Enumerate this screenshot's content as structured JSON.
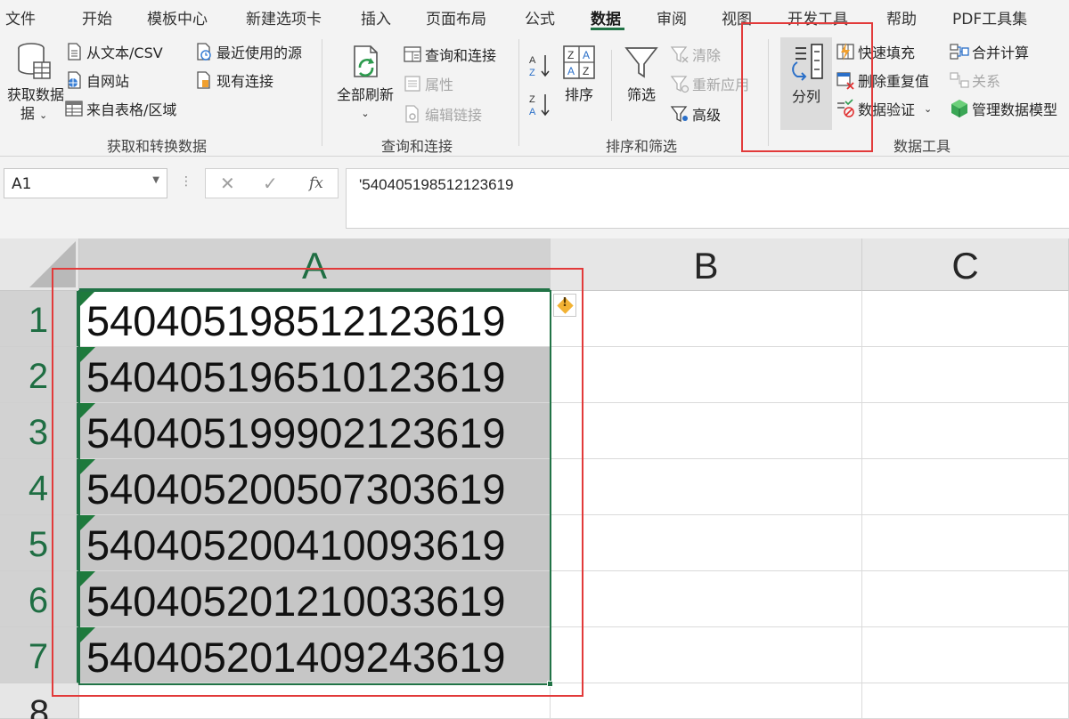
{
  "ribbon": {
    "tabs": [
      "文件",
      "开始",
      "模板中心",
      "新建选项卡",
      "插入",
      "页面布局",
      "公式",
      "数据",
      "审阅",
      "视图",
      "开发工具",
      "帮助",
      "PDF工具集"
    ],
    "active_tab": "数据",
    "get_transform": {
      "get_data": "获取数据",
      "get_data_line2": "据",
      "from_text": "从文本/CSV",
      "from_web": "自网站",
      "from_table": "来自表格/区域",
      "recent_sources": "最近使用的源",
      "existing_connections": "现有连接",
      "label": "获取和转换数据"
    },
    "queries": {
      "refresh_all": "全部刷新",
      "queries_connections": "查询和连接",
      "properties": "属性",
      "edit_links": "编辑链接",
      "label": "查询和连接"
    },
    "sort_filter": {
      "sort": "排序",
      "filter": "筛选",
      "clear": "清除",
      "reapply": "重新应用",
      "advanced": "高级",
      "label": "排序和筛选"
    },
    "data_tools": {
      "text_to_columns": "分列",
      "flash_fill": "快速填充",
      "remove_duplicates": "删除重复值",
      "data_validation": "数据验证",
      "consolidate": "合并计算",
      "relationships": "关系",
      "manage_data_model": "管理数据模型",
      "label": "数据工具"
    }
  },
  "formula_bar": {
    "name_box": "A1",
    "fx": "fx",
    "cancel": "✕",
    "enter": "✓",
    "content": "'540405198512123619"
  },
  "sheet": {
    "columns": [
      "A",
      "B",
      "C"
    ],
    "rows": [
      "1",
      "2",
      "3",
      "4",
      "5",
      "6",
      "7",
      "8"
    ],
    "column_a_values": [
      "540405198512123619",
      "540405196510123619",
      "540405199902123619",
      "540405200507303619",
      "540405200410093619",
      "540405201210033619",
      "540405201409243619"
    ],
    "error_icon": "!"
  },
  "colors": {
    "accent_green": "#217346",
    "highlight_red": "#e23a3a",
    "selection_gray": "#c6c6c6"
  }
}
